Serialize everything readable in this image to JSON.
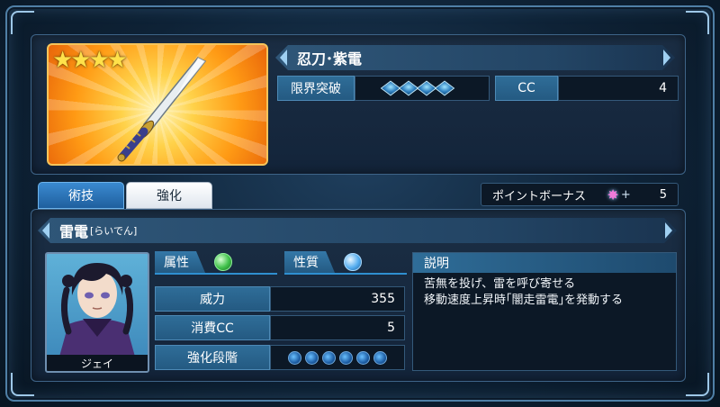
{
  "weapon": {
    "name": "忍刀･紫電",
    "stars": "★★★★",
    "limit_break_label": "限界突破",
    "limit_break_level": 4,
    "limit_break_max": 4,
    "cc_label": "CC",
    "cc_value": "4"
  },
  "tabs": {
    "skill": "術技",
    "enhance": "強化"
  },
  "bonus": {
    "label": "ポイントボーナス",
    "plus": "+",
    "value": "5"
  },
  "skill": {
    "name": "雷電",
    "reading": "[らいでん]",
    "attribute_label": "属性",
    "nature_label": "性質",
    "power_label": "威力",
    "power_value": "355",
    "cost_label": "消費CC",
    "cost_value": "5",
    "grade_label": "強化段階",
    "grade_level": 6,
    "grade_max": 6,
    "description_label": "説明",
    "description_line1": "苦無を投げ、雷を呼び寄せる",
    "description_line2": "移動速度上昇時｢闇走雷電｣を発動する"
  },
  "character": {
    "name": "ジェイ"
  },
  "colors": {
    "accent": "#2f8fd0",
    "card_gold": "#f6c45a",
    "attribute": "#3fc14a"
  },
  "icons": {
    "attribute": "wind-orb-icon",
    "nature": "water-orb-icon",
    "bonus": "point-star-icon",
    "weapon": "ninja-sword-icon"
  }
}
